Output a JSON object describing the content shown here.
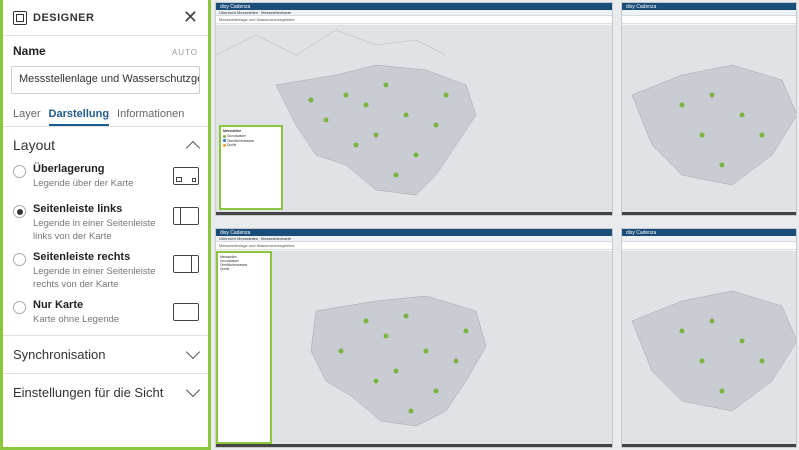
{
  "designer": {
    "title": "DESIGNER",
    "close_icon": "close-icon",
    "name_label": "Name",
    "auto_badge": "AUTO",
    "name_value": "Messstellenlage und Wasserschutzge",
    "tabs": [
      "Layer",
      "Darstellung",
      "Informationen"
    ],
    "active_tab": "Darstellung",
    "layout_heading": "Layout",
    "options": [
      {
        "title": "Überlagerung",
        "desc": "Legende über der Karte",
        "selected": false,
        "icon": "layout-overlay-icon"
      },
      {
        "title": "Seitenleiste links",
        "desc": "Legende in einer Seitenleiste links von der Karte",
        "selected": true,
        "icon": "layout-sidebar-left-icon"
      },
      {
        "title": "Seitenleiste rechts",
        "desc": "Legende in einer Seitenleiste rechts von der Karte",
        "selected": false,
        "icon": "layout-sidebar-right-icon"
      },
      {
        "title": "Nur Karte",
        "desc": "Karte ohne Legende",
        "selected": false,
        "icon": "layout-map-only-icon"
      }
    ],
    "sync_heading": "Synchronisation",
    "view_settings_heading": "Einstellungen für die Sicht"
  },
  "screens": {
    "app_title": "disy Cadenza",
    "tab_labels": [
      "Übersicht Messstellen",
      "Messstellenkarte"
    ],
    "toolbar_text": "Messstellenlage und Wasserschutzgebiete",
    "legend_title": "Messstellen",
    "legend_items": [
      "Grundwasser",
      "Oberflächenwasser",
      "Quelle"
    ],
    "legend_colors": [
      "#7cb342",
      "#2f7dbf",
      "#f0a020"
    ]
  }
}
